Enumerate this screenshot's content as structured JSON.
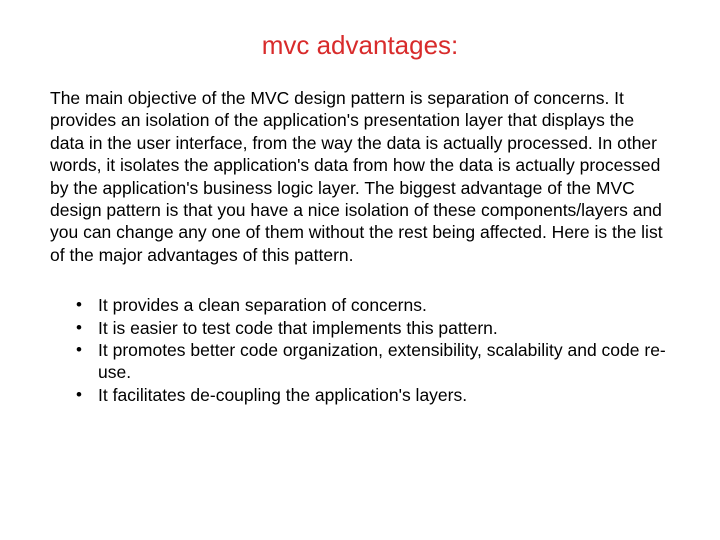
{
  "title": "mvc advantages:",
  "body": "The main objective of the MVC design pattern is separation of concerns. It provides an isolation of the application's presentation layer that displays the data in the user interface, from the way the data is actually processed. In other words, it isolates the application's data from how the data is actually processed by the application's business logic layer. The biggest advantage of the MVC design pattern is that you have a nice isolation of these components/layers and you can change any one of them without the rest being affected. Here is the list of the major advantages of this pattern.",
  "bullets": {
    "item0": "It provides a clean separation of concerns.",
    "item1": "It is easier to test code that implements this pattern.",
    "item2": "It promotes better code organization, extensibility, scalability and code re-use.",
    "item3": "It facilitates de-coupling the application's layers."
  }
}
